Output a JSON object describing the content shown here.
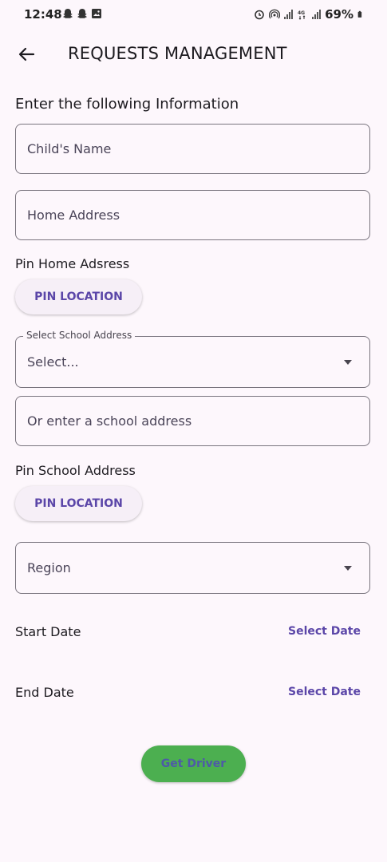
{
  "status_bar": {
    "time": "12:48",
    "left_icons": [
      "snapchat-icon",
      "snapchat-icon",
      "gallery-icon"
    ],
    "right_icons": [
      "alarm-icon",
      "hotspot-icon",
      "signal-icon",
      "4g-icon",
      "signal-icon"
    ],
    "battery": "69%"
  },
  "app_bar": {
    "title": "REQUESTS MANAGEMENT"
  },
  "form": {
    "heading": "Enter the following Information",
    "child_name_placeholder": "Child's Name",
    "home_address_placeholder": "Home Address",
    "pin_home_label": "Pin Home Adsress",
    "pin_home_button": "PIN LOCATION",
    "school_select_label": "Select School Address",
    "school_select_value": "Select...",
    "school_address_placeholder": "Or enter a school address",
    "pin_school_label": "Pin School Address",
    "pin_school_button": "PIN LOCATION",
    "region_placeholder": "Region",
    "start_date_label": "Start Date",
    "start_date_action": "Select Date",
    "end_date_label": "End Date",
    "end_date_action": "Select Date",
    "submit_button": "Get Driver"
  },
  "colors": {
    "background": "#fdf7fc",
    "accent": "#5b46a8",
    "button_green": "#4caf50",
    "border": "#79747e"
  }
}
